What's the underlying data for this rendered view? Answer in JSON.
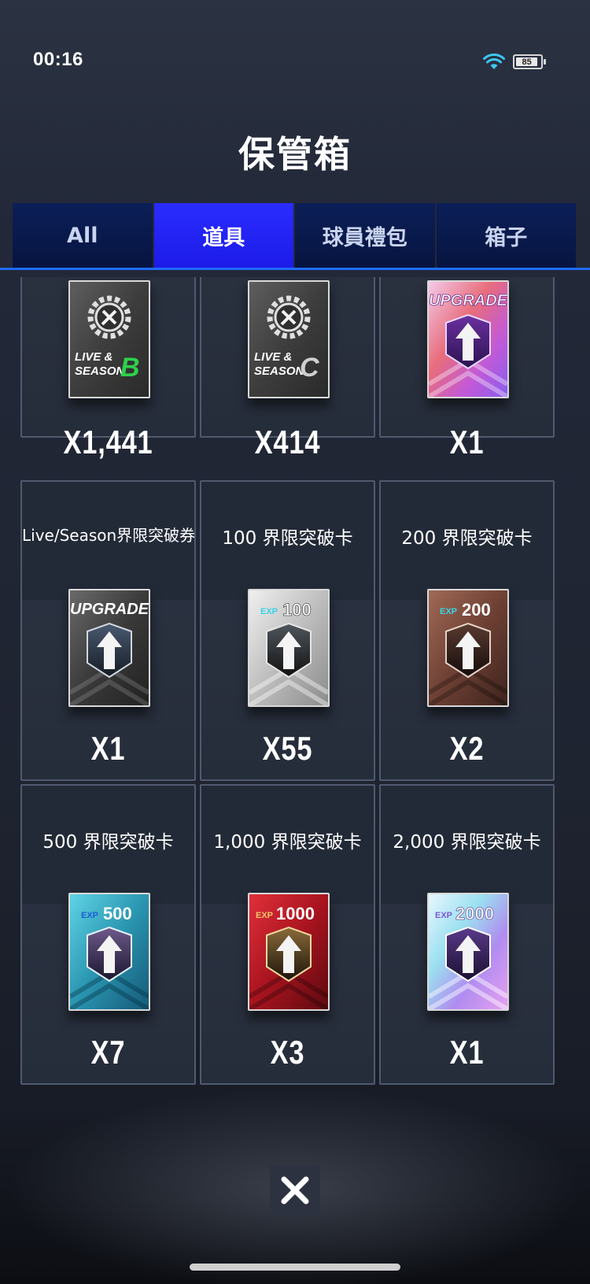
{
  "status_bar": {
    "time": "00:16",
    "battery_level": 85,
    "battery_text": "85"
  },
  "title": "保管箱",
  "tabs": [
    {
      "label": "All",
      "active": false
    },
    {
      "label": "道具",
      "active": true
    },
    {
      "label": "球員禮包",
      "active": false
    },
    {
      "label": "箱子",
      "active": false
    }
  ],
  "items": [
    {
      "label": "",
      "quantity": "X1,441",
      "icon": "live-season-b-card-icon",
      "icon_text_1": "LIVE &",
      "icon_text_2": "SEASON",
      "icon_grade": "B"
    },
    {
      "label": "",
      "quantity": "X414",
      "icon": "live-season-c-card-icon",
      "icon_text_1": "LIVE &",
      "icon_text_2": "SEASON",
      "icon_grade": "C"
    },
    {
      "label": "",
      "quantity": "X1",
      "icon": "upgrade-card-icon",
      "icon_text_1": "UPGRADE"
    },
    {
      "label": "Live/Season界限突破券",
      "quantity": "X1",
      "icon": "upgrade-ticket-icon",
      "icon_text_1": "UPGRADE"
    },
    {
      "label": "100 界限突破卡",
      "quantity": "X55",
      "icon": "exp-100-card-icon",
      "icon_exp": "EXP",
      "icon_value": "100"
    },
    {
      "label": "200 界限突破卡",
      "quantity": "X2",
      "icon": "exp-200-card-icon",
      "icon_exp": "EXP",
      "icon_value": "200"
    },
    {
      "label": "500 界限突破卡",
      "quantity": "X7",
      "icon": "exp-500-card-icon",
      "icon_exp": "EXP",
      "icon_value": "500"
    },
    {
      "label": "1,000 界限突破卡",
      "quantity": "X3",
      "icon": "exp-1000-card-icon",
      "icon_exp": "EXP",
      "icon_value": "1000"
    },
    {
      "label": "2,000 界限突破卡",
      "quantity": "X1",
      "icon": "exp-2000-card-icon",
      "icon_exp": "EXP",
      "icon_value": "2000"
    }
  ],
  "colors": {
    "tab_active": "#2a2cff",
    "tab_inactive": "#0b1f58",
    "accent_line": "#1e6bff",
    "exp_text": "#39d3e6"
  },
  "close_icon": "close-icon"
}
